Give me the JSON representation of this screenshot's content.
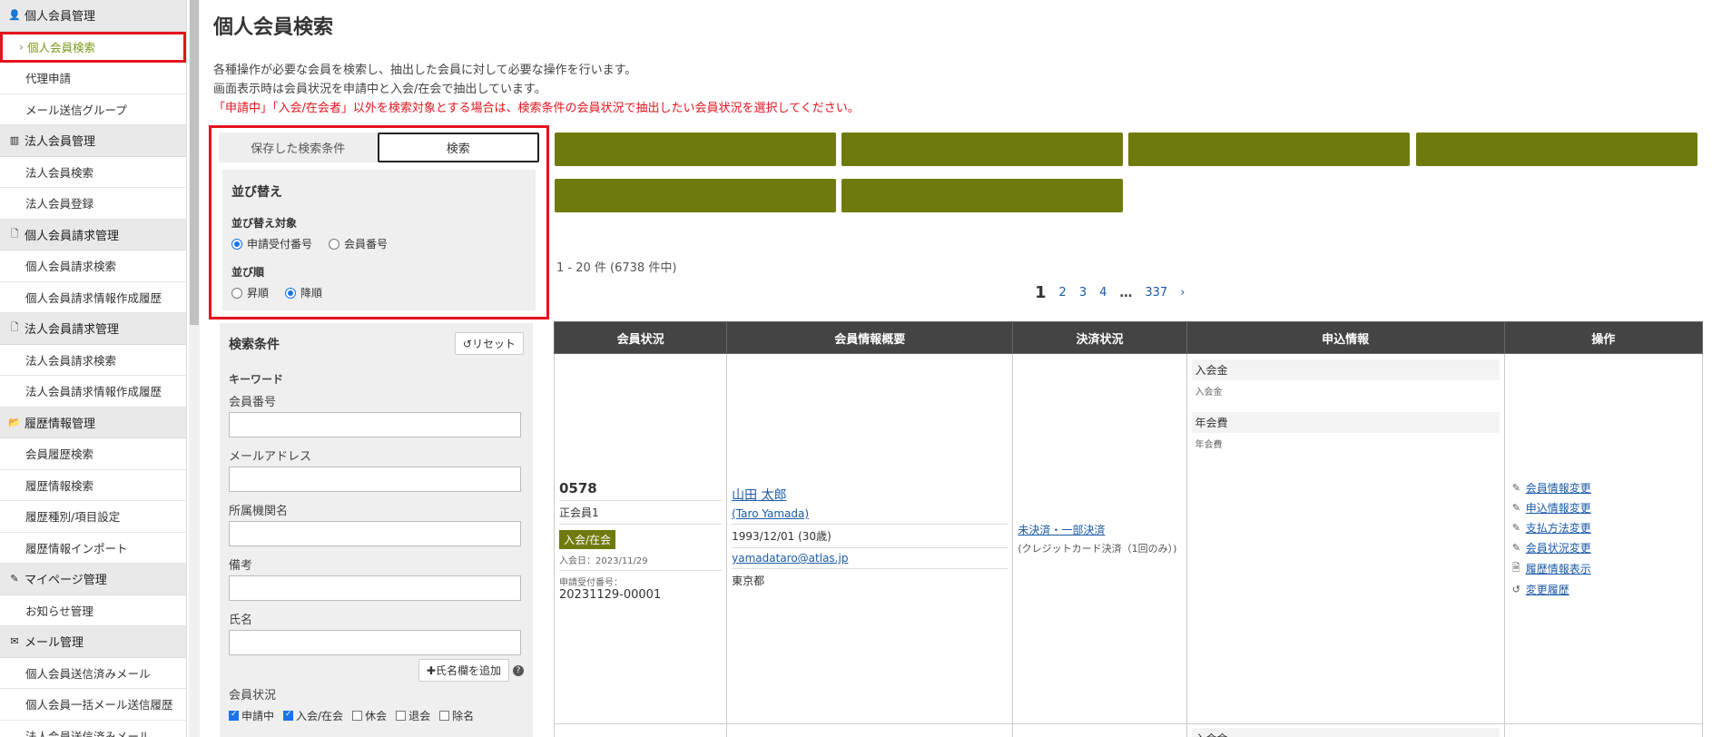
{
  "sidebar": {
    "sections": [
      {
        "title": "個人会員管理",
        "icon": "person-icon",
        "items": [
          "個人会員検索",
          "代理申請",
          "メール送信グループ"
        ]
      },
      {
        "title": "法人会員管理",
        "icon": "building-icon",
        "items": [
          "法人会員検索",
          "法人会員登録"
        ]
      },
      {
        "title": "個人会員請求管理",
        "icon": "document-icon",
        "items": [
          "個人会員請求検索",
          "個人会員請求情報作成履歴"
        ]
      },
      {
        "title": "法人会員請求管理",
        "icon": "document-icon",
        "items": [
          "法人会員請求検索",
          "法人会員請求情報作成履歴"
        ]
      },
      {
        "title": "履歴情報管理",
        "icon": "folder-icon",
        "items": [
          "会員履歴検索",
          "履歴情報検索",
          "履歴種別/項目設定",
          "履歴情報インポート"
        ]
      },
      {
        "title": "マイページ管理",
        "icon": "pen-icon",
        "items": [
          "お知らせ管理"
        ]
      },
      {
        "title": "メール管理",
        "icon": "mail-icon",
        "items": [
          "個人会員送信済みメール",
          "個人会員一括メール送信履歴",
          "法人会員送信済みメール"
        ]
      }
    ]
  },
  "main": {
    "title": "個人会員検索",
    "desc1": "各種操作が必要な会員を検索し、抽出した会員に対して必要な操作を行います。",
    "desc2": "画面表示時は会員状況を申請中と入会/在会で抽出しています。",
    "desc3": "「申請中」「入会/在会者」以外を検索対象とする場合は、検索条件の会員状況で抽出したい会員状況を選択してください。"
  },
  "tabs": {
    "saved": "保存した検索条件",
    "search": "検索"
  },
  "sort": {
    "title": "並び替え",
    "target_label": "並び替え対象",
    "target_opt1": "申請受付番号",
    "target_opt2": "会員番号",
    "order_label": "並び順",
    "order_opt1": "昇順",
    "order_opt2": "降順"
  },
  "conditions": {
    "title": "検索条件",
    "reset": "リセット",
    "keyword": "キーワード",
    "member_no": "会員番号",
    "email": "メールアドレス",
    "org": "所属機関名",
    "notes": "備考",
    "name": "氏名",
    "add_name": "氏名欄を追加",
    "status": "会員状況",
    "status_opts": [
      "申請中",
      "入会/在会",
      "休会",
      "退会",
      "除名"
    ]
  },
  "results": {
    "count": "1 - 20 件 (6738 件中)",
    "pages": [
      "1",
      "2",
      "3",
      "4",
      "…",
      "337",
      "›"
    ],
    "headers": [
      "会員状況",
      "会員情報概要",
      "決済状況",
      "申込情報",
      "操作"
    ],
    "row": {
      "member_no": "0578",
      "type": "正会員1",
      "status_badge": "入会/在会",
      "join_date": "入会日：2023/11/29",
      "receipt_label": "申請受付番号：",
      "receipt_no": "20231129-00001",
      "name": "山田 太郎",
      "name_en": "(Taro Yamada)",
      "birth": "1993/12/01 (30歳)",
      "email": "yamadataro@atlas.jp",
      "pref": "東京都",
      "payment": "未決済・一部決済",
      "payment_note": "(クレジットカード決済（1回のみ）)",
      "apply1_head": "入会金",
      "apply1_sub": "入会金",
      "apply2_head": "年会費",
      "apply2_sub": "年会費",
      "ops": [
        "会員情報変更",
        "申込情報変更",
        "支払方法変更",
        "会員状況変更",
        "履歴情報表示",
        "変更履歴"
      ]
    },
    "next_row_apply_head": "入会金"
  },
  "colors": {
    "accent_olive": "#6f7a0c",
    "highlight_red": "#e3141e",
    "link_blue": "#1a5aa8"
  }
}
